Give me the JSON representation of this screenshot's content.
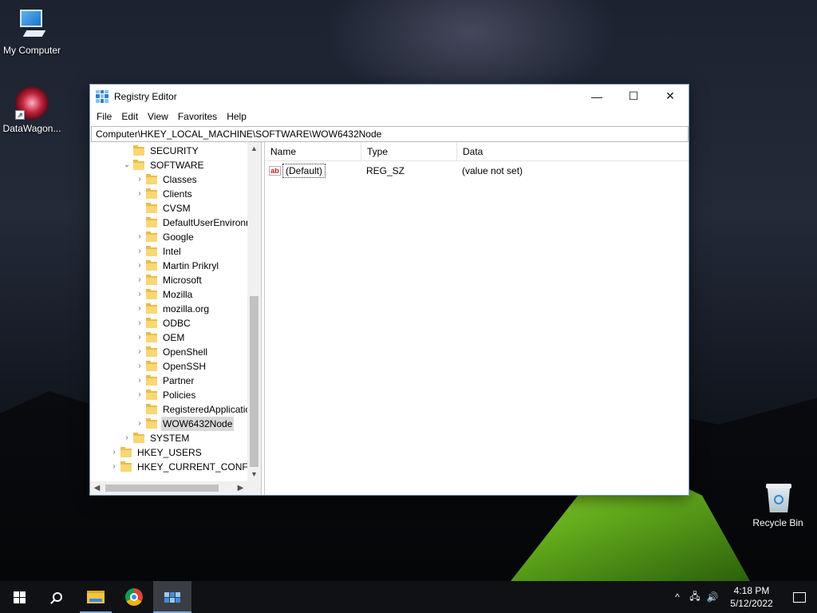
{
  "desktop": {
    "icons": [
      {
        "label": "My Computer"
      },
      {
        "label": "DataWagon..."
      },
      {
        "label": "Recycle Bin"
      }
    ]
  },
  "window": {
    "title": "Registry Editor",
    "controls": {
      "minimize": "—",
      "maximize": "☐",
      "close": "✕"
    },
    "menu": [
      "File",
      "Edit",
      "View",
      "Favorites",
      "Help"
    ],
    "address": "Computer\\HKEY_LOCAL_MACHINE\\SOFTWARE\\WOW6432Node",
    "tree": [
      {
        "label": "SECURITY",
        "expander": "",
        "level": 2
      },
      {
        "label": "SOFTWARE",
        "expander": "⌄",
        "level": 2
      },
      {
        "label": "Classes",
        "expander": "›",
        "level": 3
      },
      {
        "label": "Clients",
        "expander": "›",
        "level": 3
      },
      {
        "label": "CVSM",
        "expander": "",
        "level": 3
      },
      {
        "label": "DefaultUserEnvironn",
        "expander": "",
        "level": 3
      },
      {
        "label": "Google",
        "expander": "›",
        "level": 3
      },
      {
        "label": "Intel",
        "expander": "›",
        "level": 3
      },
      {
        "label": "Martin Prikryl",
        "expander": "›",
        "level": 3
      },
      {
        "label": "Microsoft",
        "expander": "›",
        "level": 3
      },
      {
        "label": "Mozilla",
        "expander": "›",
        "level": 3
      },
      {
        "label": "mozilla.org",
        "expander": "›",
        "level": 3
      },
      {
        "label": "ODBC",
        "expander": "›",
        "level": 3
      },
      {
        "label": "OEM",
        "expander": "›",
        "level": 3
      },
      {
        "label": "OpenShell",
        "expander": "›",
        "level": 3
      },
      {
        "label": "OpenSSH",
        "expander": "›",
        "level": 3
      },
      {
        "label": "Partner",
        "expander": "›",
        "level": 3
      },
      {
        "label": "Policies",
        "expander": "›",
        "level": 3
      },
      {
        "label": "RegisteredApplicatic",
        "expander": "",
        "level": 3
      },
      {
        "label": "WOW6432Node",
        "expander": "›",
        "level": 3,
        "selected": true
      },
      {
        "label": "SYSTEM",
        "expander": "›",
        "level": 2
      },
      {
        "label": "HKEY_USERS",
        "expander": "›",
        "level": 1
      },
      {
        "label": "HKEY_CURRENT_CONFIG",
        "expander": "›",
        "level": 1
      }
    ],
    "columns": {
      "name": "Name",
      "type": "Type",
      "data": "Data"
    },
    "values": [
      {
        "icon": "ab",
        "name": "(Default)",
        "type": "REG_SZ",
        "data": "(value not set)"
      }
    ]
  },
  "taskbar": {
    "clock": {
      "time": "4:18 PM",
      "date": "5/12/2022"
    },
    "tray_chevron": "^"
  },
  "colors": {
    "selection": "#d9d9d9",
    "folder": "#f8d775",
    "taskbar": "#101114"
  }
}
